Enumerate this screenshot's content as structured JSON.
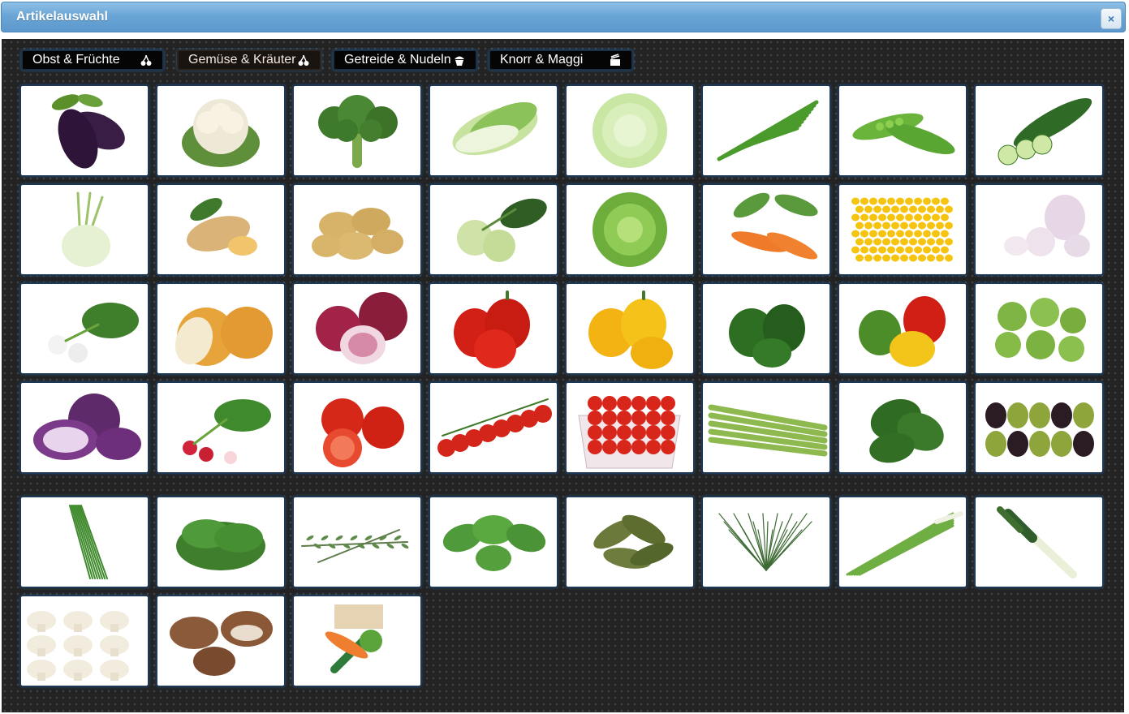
{
  "window": {
    "title": "Artikelauswahl",
    "close_label": "×"
  },
  "categories": [
    {
      "label": "Obst & Früchte",
      "icon": "cherry-icon",
      "active": false
    },
    {
      "label": "Gemüse & Kräuter",
      "icon": "cherry-icon",
      "active": true
    },
    {
      "label": "Getreide & Nudeln",
      "icon": "cupcake-icon",
      "active": false
    },
    {
      "label": "Knorr & Maggi",
      "icon": "food-bowl-icon",
      "active": false
    }
  ],
  "products": [
    "eggplant",
    "cauliflower",
    "broccoli",
    "chinese-cabbage",
    "iceberg-lettuce",
    "green-beans",
    "peas",
    "cucumber",
    "fennel",
    "ginger",
    "potatoes",
    "kohlrabi",
    "lettuce",
    "carrots",
    "corn",
    "garlic",
    "turnips",
    "onions",
    "red-onions",
    "red-peppers",
    "yellow-peppers",
    "green-peppers",
    "mixed-peppers",
    "brussels-sprouts",
    "red-cabbage",
    "radishes",
    "tomatoes",
    "cherry-tomatoes-vine",
    "cherry-tomatoes-box",
    "green-asparagus",
    "spinach",
    "olives",
    "chives",
    "kale",
    "rosemary",
    "oregano",
    "bay-leaves",
    "dill",
    "spring-onions",
    "leek",
    "mushrooms",
    "brown-mushrooms",
    "soup-vegetables"
  ]
}
